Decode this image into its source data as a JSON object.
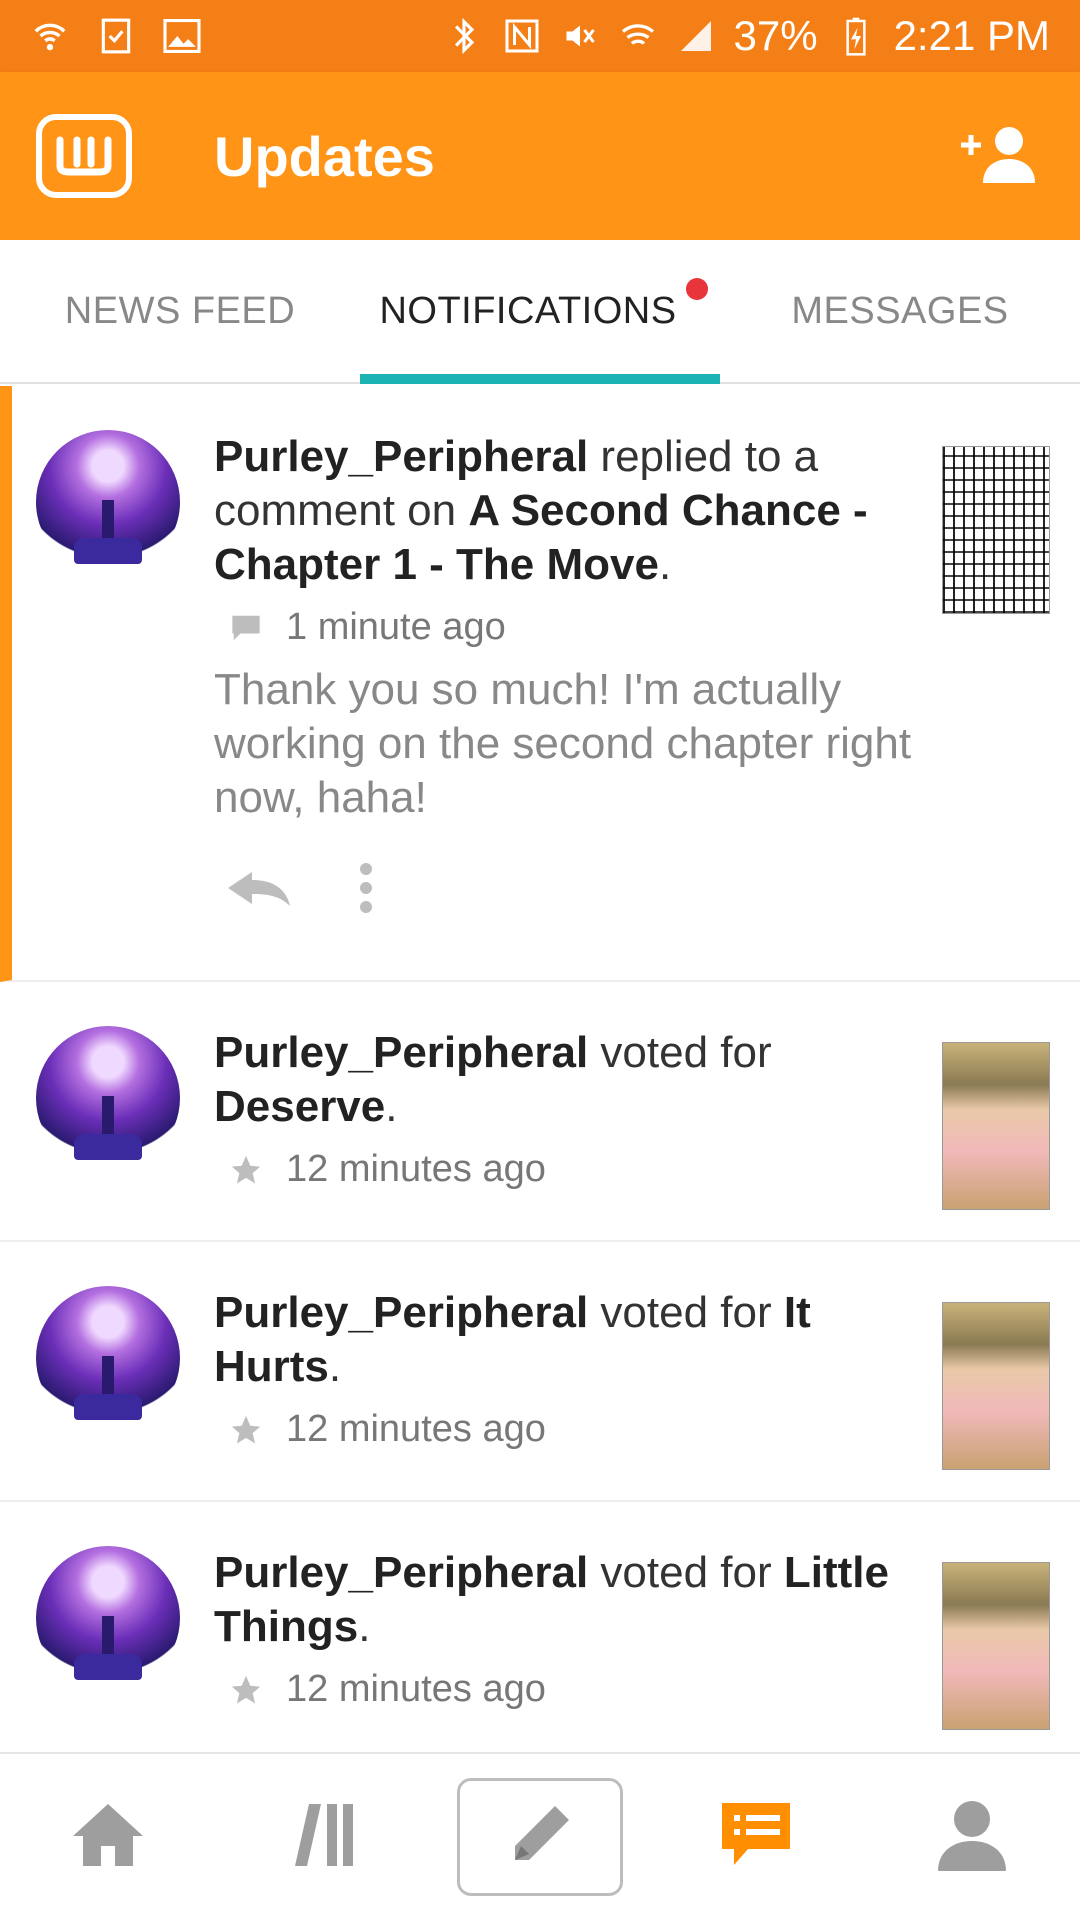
{
  "status_bar": {
    "battery": "37%",
    "time": "2:21 PM",
    "icons": [
      "wifi-call-icon",
      "checklist-icon",
      "image-icon",
      "bluetooth-icon",
      "nfc-icon",
      "mute-icon",
      "wifi-icon",
      "signal-icon",
      "battery-charging-icon"
    ]
  },
  "app_bar": {
    "title": "Updates",
    "logo_icon": "wattpad-logo",
    "action_icon": "add-user-icon"
  },
  "tabs": [
    {
      "label": "NEWS FEED",
      "active": false,
      "badge": false
    },
    {
      "label": "NOTIFICATIONS",
      "active": true,
      "badge": true
    },
    {
      "label": "MESSAGES",
      "active": false,
      "badge": false
    }
  ],
  "notifications": [
    {
      "user": "Purley_Peripheral",
      "action": " replied to a comment on ",
      "target": "A Second Chance - Chapter 1 - The Move",
      "period": ".",
      "icon": "comment-icon",
      "time": "1 minute ago",
      "message": "Thank you so much! I'm actually working on the second chapter right now, haha!",
      "unread": true
    },
    {
      "user": "Purley_Peripheral",
      "action": " voted for ",
      "target": "Deserve",
      "period": ".",
      "icon": "star-icon",
      "time": "12 minutes ago"
    },
    {
      "user": "Purley_Peripheral",
      "action": " voted for ",
      "target": "It Hurts",
      "period": ".",
      "icon": "star-icon",
      "time": "12 minutes ago"
    },
    {
      "user": "Purley_Peripheral",
      "action": " voted for ",
      "target": "Little Things",
      "period": ".",
      "icon": "star-icon",
      "time": "12 minutes ago"
    }
  ],
  "bottom_nav": {
    "items": [
      "home-icon",
      "library-icon",
      "write-icon",
      "updates-icon",
      "profile-icon"
    ],
    "active": "updates-icon"
  },
  "colors": {
    "status_bar": "#f57f17",
    "app_bar": "#ff9417",
    "tab_indicator": "#1bb3b3",
    "badge": "#e8343b",
    "active_nav": "#ff8f00",
    "inactive_nav": "#9e9e9e"
  }
}
